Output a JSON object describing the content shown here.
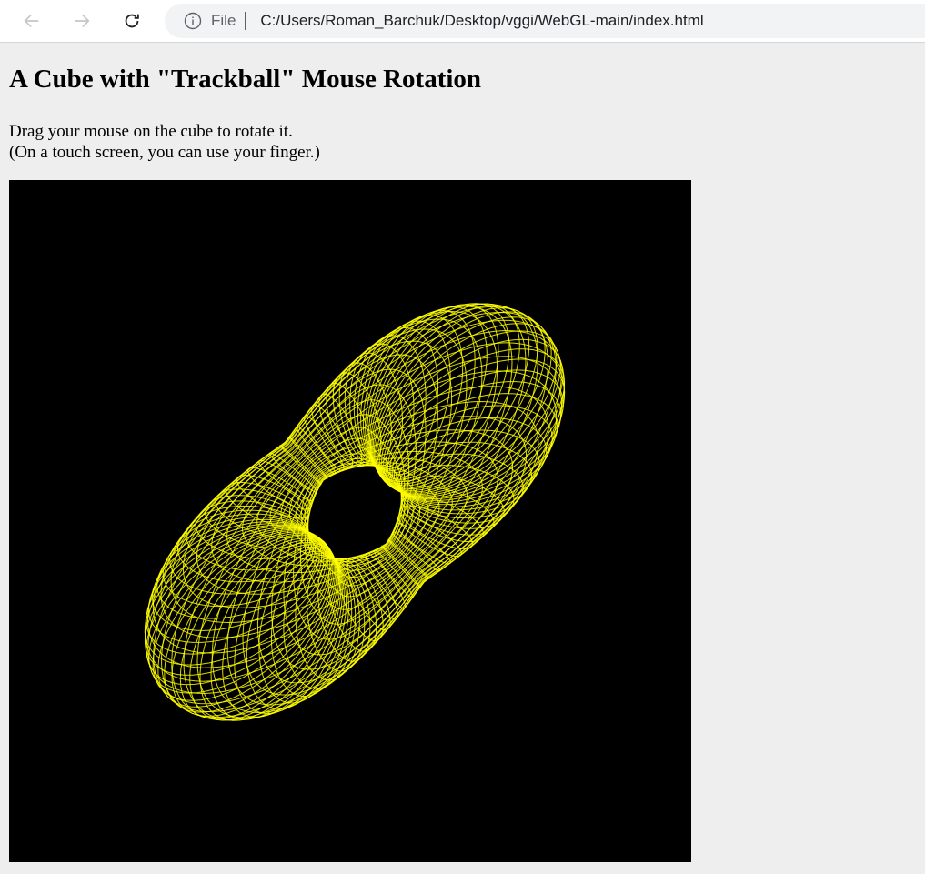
{
  "browser": {
    "back_icon": "arrow-left-icon",
    "forward_icon": "arrow-right-icon",
    "reload_icon": "reload-icon",
    "info_icon": "info-icon",
    "scheme_label": "File",
    "url": "C:/Users/Roman_Barchuk/Desktop/vggi/WebGL-main/index.html"
  },
  "page": {
    "title": "A Cube with \"Trackball\" Mouse Rotation",
    "instruction_line1": "Drag your mouse on the cube to rotate it.",
    "instruction_line2": "(On a touch screen, you can use your finger.)"
  },
  "canvas": {
    "background": "#000000",
    "wire_color": "#ffff00",
    "shape": "wireframe twisted torus surface"
  }
}
